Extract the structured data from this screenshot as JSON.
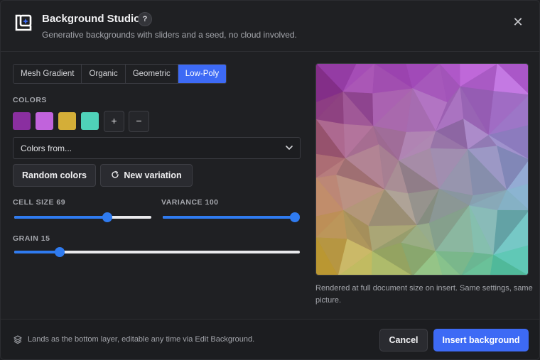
{
  "header": {
    "title": "Background Studio",
    "help": "?",
    "subtitle": "Generative backgrounds with sliders and a seed, no cloud involved.",
    "close": "✕"
  },
  "tabs": [
    {
      "label": "Mesh Gradient",
      "active": false
    },
    {
      "label": "Organic",
      "active": false
    },
    {
      "label": "Geometric",
      "active": false
    },
    {
      "label": "Low-Poly",
      "active": true
    }
  ],
  "colors": {
    "label": "COLORS",
    "swatches": [
      "#8a2fa0",
      "#c163dc",
      "#d4ae38",
      "#4fd2b9"
    ],
    "add": "+",
    "remove": "−"
  },
  "palette_select": {
    "value": "Colors from..."
  },
  "buttons": {
    "random": "Random colors",
    "variation": "New variation",
    "variation_icon": "refresh-icon"
  },
  "sliders": {
    "cell_size": {
      "label": "CELL SIZE 69",
      "fraction": 0.68
    },
    "variance": {
      "label": "VARIANCE 100",
      "fraction": 1.0
    },
    "grain": {
      "label": "GRAIN 15",
      "fraction": 0.16
    }
  },
  "preview": {
    "caption": "Rendered at full document size on insert. Same settings, same picture."
  },
  "footer": {
    "note": "Lands as the bottom layer, editable any time via Edit Background.",
    "cancel": "Cancel",
    "insert": "Insert background"
  },
  "theme": {
    "accent": "#3d6af5",
    "slider": "#2f7bf0"
  }
}
